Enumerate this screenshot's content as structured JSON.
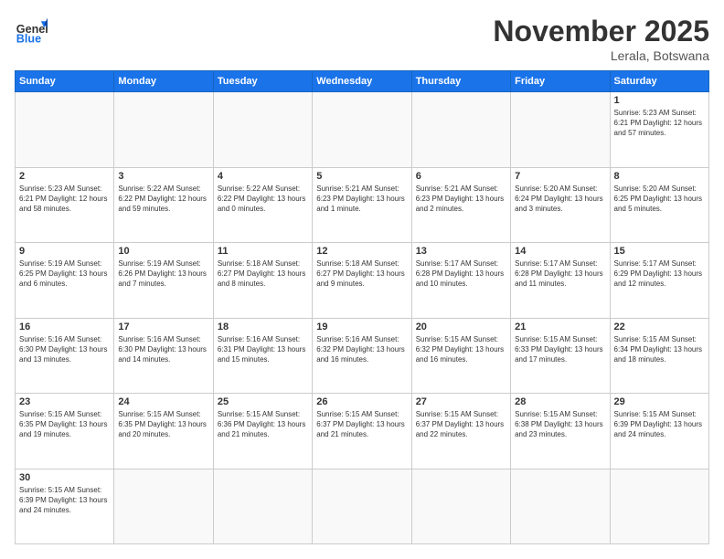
{
  "header": {
    "logo_general": "General",
    "logo_blue": "Blue",
    "title": "November 2025",
    "subtitle": "Lerala, Botswana"
  },
  "weekdays": [
    "Sunday",
    "Monday",
    "Tuesday",
    "Wednesday",
    "Thursday",
    "Friday",
    "Saturday"
  ],
  "weeks": [
    [
      {
        "day": "",
        "info": ""
      },
      {
        "day": "",
        "info": ""
      },
      {
        "day": "",
        "info": ""
      },
      {
        "day": "",
        "info": ""
      },
      {
        "day": "",
        "info": ""
      },
      {
        "day": "",
        "info": ""
      },
      {
        "day": "1",
        "info": "Sunrise: 5:23 AM\nSunset: 6:21 PM\nDaylight: 12 hours and 57 minutes."
      }
    ],
    [
      {
        "day": "2",
        "info": "Sunrise: 5:23 AM\nSunset: 6:21 PM\nDaylight: 12 hours and 58 minutes."
      },
      {
        "day": "3",
        "info": "Sunrise: 5:22 AM\nSunset: 6:22 PM\nDaylight: 12 hours and 59 minutes."
      },
      {
        "day": "4",
        "info": "Sunrise: 5:22 AM\nSunset: 6:22 PM\nDaylight: 13 hours and 0 minutes."
      },
      {
        "day": "5",
        "info": "Sunrise: 5:21 AM\nSunset: 6:23 PM\nDaylight: 13 hours and 1 minute."
      },
      {
        "day": "6",
        "info": "Sunrise: 5:21 AM\nSunset: 6:23 PM\nDaylight: 13 hours and 2 minutes."
      },
      {
        "day": "7",
        "info": "Sunrise: 5:20 AM\nSunset: 6:24 PM\nDaylight: 13 hours and 3 minutes."
      },
      {
        "day": "8",
        "info": "Sunrise: 5:20 AM\nSunset: 6:25 PM\nDaylight: 13 hours and 5 minutes."
      }
    ],
    [
      {
        "day": "9",
        "info": "Sunrise: 5:19 AM\nSunset: 6:25 PM\nDaylight: 13 hours and 6 minutes."
      },
      {
        "day": "10",
        "info": "Sunrise: 5:19 AM\nSunset: 6:26 PM\nDaylight: 13 hours and 7 minutes."
      },
      {
        "day": "11",
        "info": "Sunrise: 5:18 AM\nSunset: 6:27 PM\nDaylight: 13 hours and 8 minutes."
      },
      {
        "day": "12",
        "info": "Sunrise: 5:18 AM\nSunset: 6:27 PM\nDaylight: 13 hours and 9 minutes."
      },
      {
        "day": "13",
        "info": "Sunrise: 5:17 AM\nSunset: 6:28 PM\nDaylight: 13 hours and 10 minutes."
      },
      {
        "day": "14",
        "info": "Sunrise: 5:17 AM\nSunset: 6:28 PM\nDaylight: 13 hours and 11 minutes."
      },
      {
        "day": "15",
        "info": "Sunrise: 5:17 AM\nSunset: 6:29 PM\nDaylight: 13 hours and 12 minutes."
      }
    ],
    [
      {
        "day": "16",
        "info": "Sunrise: 5:16 AM\nSunset: 6:30 PM\nDaylight: 13 hours and 13 minutes."
      },
      {
        "day": "17",
        "info": "Sunrise: 5:16 AM\nSunset: 6:30 PM\nDaylight: 13 hours and 14 minutes."
      },
      {
        "day": "18",
        "info": "Sunrise: 5:16 AM\nSunset: 6:31 PM\nDaylight: 13 hours and 15 minutes."
      },
      {
        "day": "19",
        "info": "Sunrise: 5:16 AM\nSunset: 6:32 PM\nDaylight: 13 hours and 16 minutes."
      },
      {
        "day": "20",
        "info": "Sunrise: 5:15 AM\nSunset: 6:32 PM\nDaylight: 13 hours and 16 minutes."
      },
      {
        "day": "21",
        "info": "Sunrise: 5:15 AM\nSunset: 6:33 PM\nDaylight: 13 hours and 17 minutes."
      },
      {
        "day": "22",
        "info": "Sunrise: 5:15 AM\nSunset: 6:34 PM\nDaylight: 13 hours and 18 minutes."
      }
    ],
    [
      {
        "day": "23",
        "info": "Sunrise: 5:15 AM\nSunset: 6:35 PM\nDaylight: 13 hours and 19 minutes."
      },
      {
        "day": "24",
        "info": "Sunrise: 5:15 AM\nSunset: 6:35 PM\nDaylight: 13 hours and 20 minutes."
      },
      {
        "day": "25",
        "info": "Sunrise: 5:15 AM\nSunset: 6:36 PM\nDaylight: 13 hours and 21 minutes."
      },
      {
        "day": "26",
        "info": "Sunrise: 5:15 AM\nSunset: 6:37 PM\nDaylight: 13 hours and 21 minutes."
      },
      {
        "day": "27",
        "info": "Sunrise: 5:15 AM\nSunset: 6:37 PM\nDaylight: 13 hours and 22 minutes."
      },
      {
        "day": "28",
        "info": "Sunrise: 5:15 AM\nSunset: 6:38 PM\nDaylight: 13 hours and 23 minutes."
      },
      {
        "day": "29",
        "info": "Sunrise: 5:15 AM\nSunset: 6:39 PM\nDaylight: 13 hours and 24 minutes."
      }
    ],
    [
      {
        "day": "30",
        "info": "Sunrise: 5:15 AM\nSunset: 6:39 PM\nDaylight: 13 hours and 24 minutes."
      },
      {
        "day": "",
        "info": ""
      },
      {
        "day": "",
        "info": ""
      },
      {
        "day": "",
        "info": ""
      },
      {
        "day": "",
        "info": ""
      },
      {
        "day": "",
        "info": ""
      },
      {
        "day": "",
        "info": ""
      }
    ]
  ]
}
